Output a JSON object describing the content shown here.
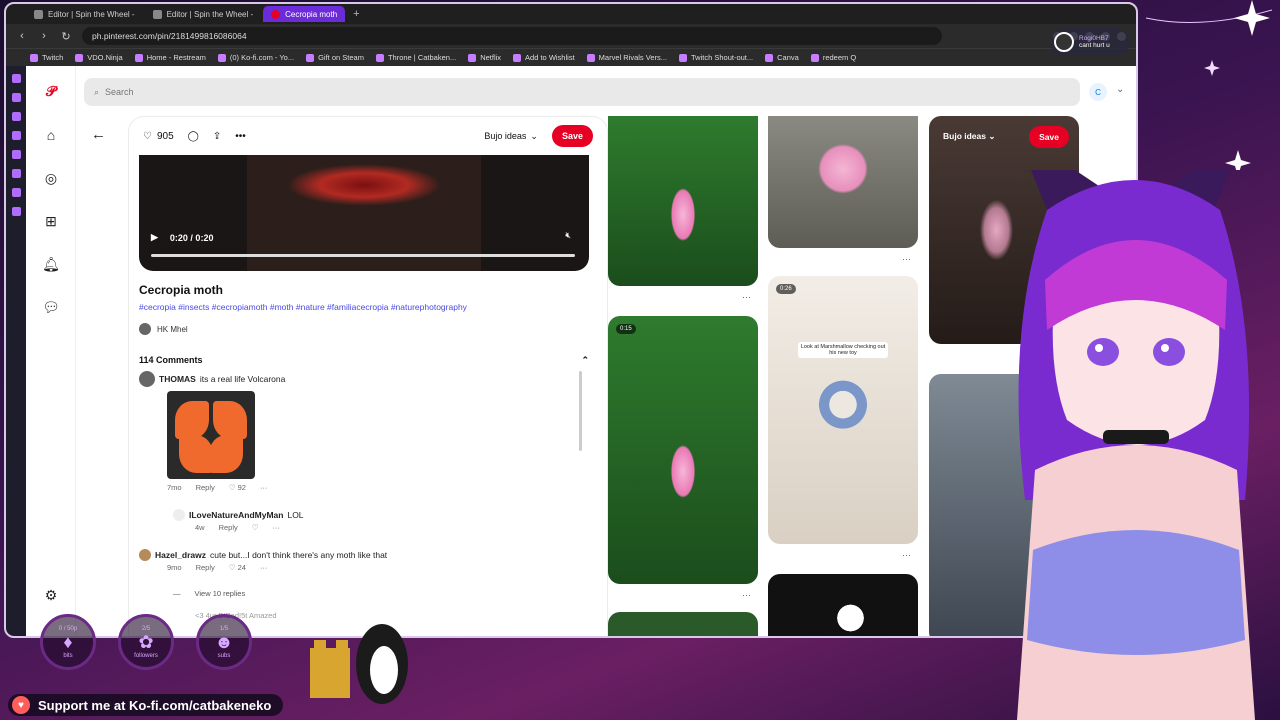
{
  "browser": {
    "tabs": [
      {
        "label": "Editor | Spin the Wheel -",
        "active": false
      },
      {
        "label": "Editor | Spin the Wheel -",
        "active": false
      },
      {
        "label": "Cecropia moth",
        "active": true
      }
    ],
    "url": "ph.pinterest.com/pin/2181499816086064",
    "bookmarks": [
      "Twitch",
      "VDO.Ninja",
      "Home - Restream",
      "(0) Ko-fi.com - Yo...",
      "Gift on Steam",
      "Throne | Catbaken...",
      "Netflix",
      "Add to Wishlist",
      "Marvel Rivals Vers...",
      "Twitch Shout-out...",
      "Canva",
      "redeem Q"
    ]
  },
  "pinterest": {
    "search_placeholder": "Search",
    "avatar_letter": "C",
    "pin": {
      "likes": "905",
      "board": "Bujo ideas",
      "save": "Save",
      "time": "0:20 / 0:20",
      "title": "Cecropia moth",
      "tags": "#cecropia #insects #cecropiamoth #moth #nature #familiacecropia #naturephotography",
      "author": "HK Mhel",
      "comments_count": "114 Comments"
    },
    "comments": [
      {
        "user": "THOMAS",
        "text": "its a real life Volcarona",
        "age": "7mo",
        "reply": "Reply",
        "likes": "92"
      },
      {
        "user": "ILoveNatureAndMyMan",
        "text": "LOL",
        "age": "4w",
        "reply": "Reply",
        "likes": ""
      },
      {
        "user": "Hazel_drawz",
        "text": "cute but...I don't think there's any moth like that",
        "age": "9mo",
        "reply": "Reply",
        "likes": "24"
      }
    ],
    "view_replies": "View 10 replies",
    "truncated_user": "<3 4ur B!Bad!5t Amazed",
    "grid": {
      "pin_board": "Bujo ideas",
      "pin_save": "Save",
      "duration1": "0:15",
      "duration2": "0:26",
      "card_caption": "Look at Marshmallow checking out his new toy"
    }
  },
  "overlay": {
    "goals": [
      {
        "top": "0 / 50p",
        "label": "bits",
        "icon": "gem"
      },
      {
        "top": "2/5",
        "label": "followers",
        "icon": "paw"
      },
      {
        "top": "1/5",
        "label": "subs",
        "icon": "cat"
      }
    ],
    "kofi": "Support me at Ko-fi.com/catbakeneko",
    "chat_user": "Rogi0HB7",
    "chat_text": "cant hurt u"
  }
}
